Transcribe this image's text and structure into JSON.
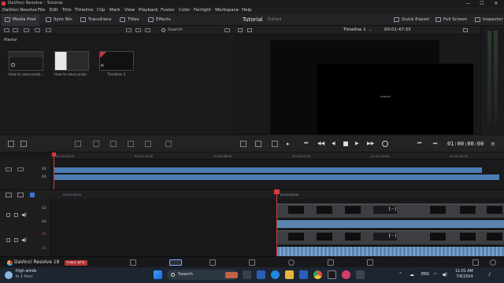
{
  "window": {
    "title": "DaVinci Resolve - Tutorial",
    "controls": [
      "—",
      "☐",
      "✕"
    ]
  },
  "menu": [
    "DaVinci Resolve",
    "File",
    "Edit",
    "Trim",
    "Timeline",
    "Clip",
    "Mark",
    "View",
    "Playback",
    "Fusion",
    "Color",
    "Fairlight",
    "Workspace",
    "Help"
  ],
  "toolbar": {
    "media_pool": "Media Pool",
    "sync_bin": "Sync Bin",
    "transitions": "Transitions",
    "titles": "Titles",
    "effects": "Effects",
    "project_name": "Tutorial",
    "project_status": "Edited",
    "quick_export": "Quick Export",
    "full_screen": "Full Screen",
    "inspector": "Inspector"
  },
  "media_pool": {
    "bin_name": "Master",
    "search_placeholder": "Search",
    "clips": [
      {
        "label": "How to save proje..."
      },
      {
        "label": "How to save proje..."
      },
      {
        "label": "Timeline 1"
      }
    ]
  },
  "viewer": {
    "timeline_name": "Timeline 1",
    "timecode": "00:01:47:33",
    "tiny_text": "tutorial"
  },
  "transport": {
    "timecode": "01:00:00:00"
  },
  "upper_ruler": [
    "01:00:00:00",
    "01:00:19:00",
    "01:00:38:00",
    "01:00:57:00",
    "01:01:16:00",
    "01:01:35:00"
  ],
  "lower_ruler": [
    "00:59:58:00",
    "01:00:00:00"
  ],
  "tracks": {
    "upper": [
      "V1",
      "A1"
    ],
    "lower": [
      "V2",
      "A2",
      "V1",
      "A1"
    ]
  },
  "pagebar": {
    "app_label": "DaVinci Resolve 19",
    "badge": "PUBLIC BETA",
    "pages": [
      "media",
      "cut",
      "edit",
      "fusion",
      "color",
      "fairlight",
      "deliver"
    ],
    "selected_page": "cut"
  },
  "taskbar": {
    "weather_title": "High winds",
    "weather_sub": "In 1 hour",
    "search": "Search",
    "lang": "ENG",
    "time": "11:01 AM",
    "date": "7/6/2024"
  },
  "colors": {
    "accent_red": "#d83c3c",
    "track_blue": "#4a7eb5",
    "badge_red": "#b23434"
  }
}
